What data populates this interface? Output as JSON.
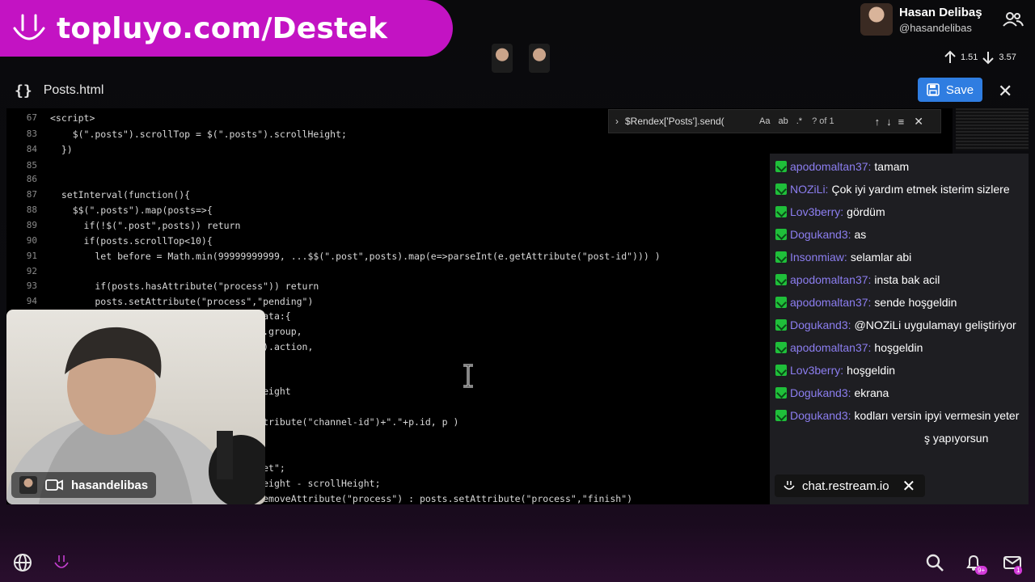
{
  "banner": {
    "text": "topluyo.com/Destek"
  },
  "profile": {
    "name": "Hasan Delibaş",
    "handle": "@hasandelibas"
  },
  "votes": {
    "up": "1.51",
    "down": "3.57"
  },
  "editor": {
    "file_name": "Posts.html",
    "save_label": "Save",
    "lines": [
      {
        "n": "67",
        "code": "<script>"
      },
      {
        "n": "83",
        "code": "    $(\".posts\").scrollTop = $(\".posts\").scrollHeight;"
      },
      {
        "n": "84",
        "code": "  })"
      },
      {
        "n": "85",
        "code": ""
      },
      {
        "n": "86",
        "code": ""
      },
      {
        "n": "87",
        "code": "  setInterval(function(){"
      },
      {
        "n": "88",
        "code": "    $$(\".posts\").map(posts=>{"
      },
      {
        "n": "89",
        "code": "      if(!$(\".post\",posts)) return"
      },
      {
        "n": "90",
        "code": "      if(posts.scrollTop<10){"
      },
      {
        "n": "91",
        "code": "        let before = Math.min(99999999999, ...$$(\".post\",posts).map(e=>parseInt(e.getAttribute(\"post-id\"))) )"
      },
      {
        "n": "92",
        "code": ""
      },
      {
        "n": "93",
        "code": "        if(posts.hasAttribute(\"process\")) return"
      },
      {
        "n": "94",
        "code": "        posts.setAttribute(\"process\",\"pending\")"
      },
      {
        "n": "",
        "code": "                              /list\",data:{"
      },
      {
        "n": "",
        "code": "                              meters().group,"
      },
      {
        "n": "",
        "code": "                              ameters().action,"
      },
      {
        "n": "",
        "code": ""
      },
      {
        "n": "",
        "code": "                              .scrollHeight"
      },
      {
        "n": "",
        "code": "                              )){"
      },
      {
        "n": "",
        "code": "                              ts.getAttribute(\"channel-id\")+\".\"+p.id, p )"
      },
      {
        "n": "",
        "code": ""
      },
      {
        "n": "",
        "code": "                              rFix();"
      },
      {
        "n": "",
        "code": "                              or= \"unset\";"
      },
      {
        "n": "",
        "code": "                              .scrollHeight - scrollHeight;"
      },
      {
        "n": "",
        "code": "                               posts.removeAttribute(\"process\") : posts.setAttribute(\"process\",\"finish\")"
      }
    ]
  },
  "find": {
    "query": "$Rendex['Posts'].send(",
    "opt_case": "Aa",
    "opt_word": "ab",
    "opt_regex": ".*",
    "count": "? of 1"
  },
  "webcam": {
    "name": "hasandelibas"
  },
  "chat": {
    "messages": [
      {
        "user": "apodomaltan37:",
        "text": "tamam"
      },
      {
        "user": "NOZiLi:",
        "text": "Çok iyi yardım etmek isterim sizlere"
      },
      {
        "user": "Lov3berry:",
        "text": "gördüm"
      },
      {
        "user": "Dogukand3:",
        "text": "as"
      },
      {
        "user": "Insonmiaw:",
        "text": "selamlar abi"
      },
      {
        "user": "apodomaltan37:",
        "text": "insta bak acil"
      },
      {
        "user": "apodomaltan37:",
        "text": "sende hoşgeldin"
      },
      {
        "user": "Dogukand3:",
        "text": "@NOZiLi uygulamayı geliştiriyor"
      },
      {
        "user": "apodomaltan37:",
        "text": "hoşgeldin"
      },
      {
        "user": "Lov3berry:",
        "text": "hoşgeldin"
      },
      {
        "user": "Dogukand3:",
        "text": "ekrana"
      },
      {
        "user": "Dogukand3:",
        "text": "kodları versin ipyi vermesin yeter"
      }
    ],
    "partial_tail": "ş yapıyorsun",
    "restream_label": "chat.restream.io"
  },
  "bottom": {
    "notif_count": "9+",
    "mail_count": "1"
  }
}
